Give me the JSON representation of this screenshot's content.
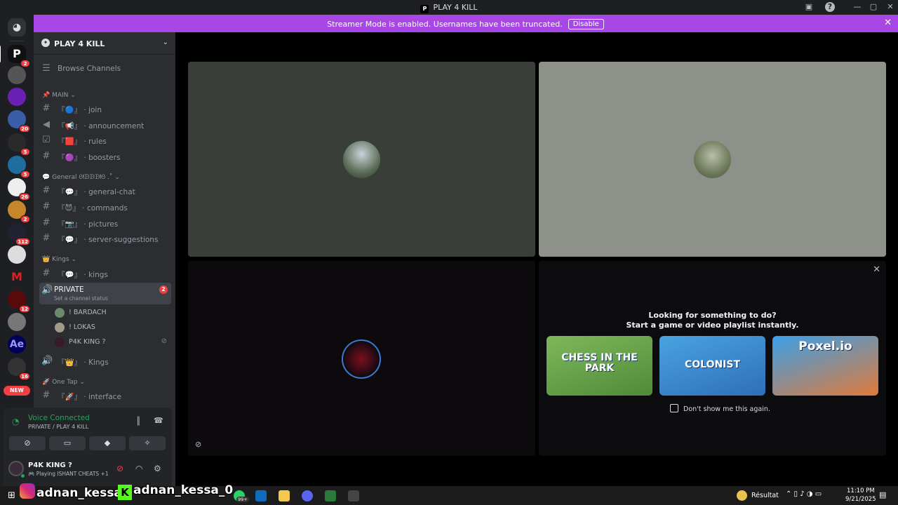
{
  "window": {
    "title": "PLAY 4 KILL",
    "logo_letter": "P"
  },
  "banner": {
    "message": "Streamer Mode is enabled. Usernames have been truncated.",
    "disable_label": "Disable"
  },
  "guild_badges": [
    "2",
    "20",
    "5",
    "5",
    "26",
    "2",
    "112",
    "12",
    "16"
  ],
  "guild_new_label": "NEW",
  "guild_ae_label": "Ae",
  "server": {
    "name": "PLAY 4 KILL",
    "browse": "Browse Channels"
  },
  "categories": {
    "main": "MAIN",
    "general": "General ᘛᗬᗬᗬᘚ .˚",
    "kings": "Kings",
    "onetap": "One Tap"
  },
  "channels": {
    "join": "『🔵』 · join",
    "announcement": "『📢』 · announcement",
    "rules": "『🟥』 · rules",
    "boosters": "『🟣』 · boosters",
    "general_chat": "『💬』 · general-chat",
    "commands": "『😈』 · commands",
    "pictures": "『📷』 · pictures",
    "server_suggestions": "『💬』 · server-suggestions",
    "kings": "『💬』 · kings",
    "private": "PRIVATE",
    "private_status": "Set a channel status",
    "private_badge": "2",
    "kings_voice": "『👑』 · Kings",
    "interface": "『🚀』 · interface"
  },
  "voice_users": [
    "! BARDACH",
    "! LOKAS",
    "P4K KING ?"
  ],
  "voice_panel": {
    "status": "Voice Connected",
    "location": "PRIVATE / PLAY 4 KILL"
  },
  "user_panel": {
    "name": "P4K KING ?",
    "status": "Playing ISHANT CHEATS",
    "extra": "+1"
  },
  "activity": {
    "line1": "Looking for something to do?",
    "line2": "Start a game or video playlist instantly.",
    "cards": [
      {
        "title": "CHESS IN THE PARK"
      },
      {
        "title": "COLONIST"
      },
      {
        "title": "Poxel.io"
      }
    ],
    "dont_show": "Don't show me this again."
  },
  "overlay": {
    "handle1": "adnan_kessa_",
    "handle2": "adnan_kessa_0"
  },
  "taskbar": {
    "weather": "Résultat",
    "time": "11:10 PM",
    "date": "9/21/2025",
    "whatsapp_badge": "99+"
  },
  "colors": {
    "accent": "#a947e6",
    "green": "#23a55a",
    "red": "#f23f43",
    "tile1": "#3a3e38",
    "tile2": "#8e918a",
    "tile3": "#0d0a0e"
  }
}
